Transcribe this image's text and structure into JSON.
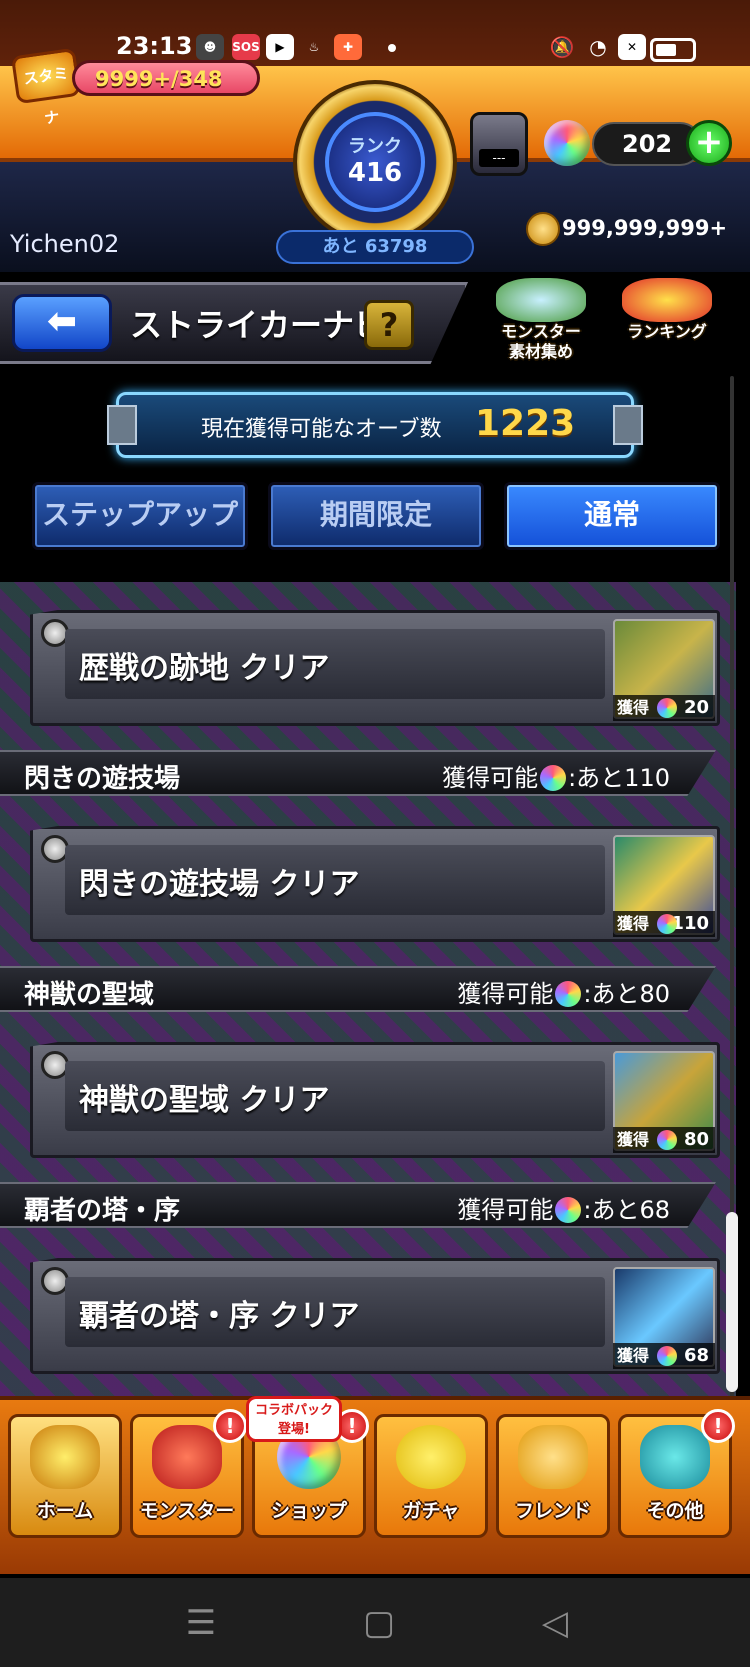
{
  "status_bar": {
    "time": "23:13",
    "icons": [
      "discord-icon",
      "sos-icon",
      "youtube-icon",
      "app-icon",
      "game-icon",
      "mute-icon",
      "wifi-icon",
      "sim-icon",
      "battery-icon"
    ],
    "sos_label": "SOS"
  },
  "header": {
    "stamina_label": "スタミナ",
    "stamina_value": "9999+/348",
    "rank_label": "ランク",
    "rank_value": "416",
    "rank_next": "あと 63798",
    "gauge_value": "---",
    "orb_count": "202",
    "username": "Yichen02",
    "coins": "999,999,999+"
  },
  "titlebar": {
    "title": "ストライカーナビ",
    "help": "?",
    "material_btn_line1": "モンスター",
    "material_btn_line2": "素材集め",
    "ranking_btn": "ランキング"
  },
  "orb_banner": {
    "label": "現在獲得可能なオーブ数",
    "value": "1223"
  },
  "tabs": [
    {
      "label": "ステップアップ",
      "active": false
    },
    {
      "label": "期間限定",
      "active": false
    },
    {
      "label": "通常",
      "active": true
    }
  ],
  "reward_prefix": "獲得",
  "sections": [
    {
      "mission": {
        "title": "歴戦の跡地 クリア",
        "reward": "20"
      }
    },
    {
      "name": "閃きの遊技場",
      "available_prefix": "獲得可能",
      "remaining": ":あと110",
      "mission": {
        "title": "閃きの遊技場 クリア",
        "reward": "110"
      }
    },
    {
      "name": "神獣の聖域",
      "available_prefix": "獲得可能",
      "remaining": ":あと80",
      "mission": {
        "title": "神獣の聖域 クリア",
        "reward": "80"
      }
    },
    {
      "name": "覇者の塔・序",
      "available_prefix": "獲得可能",
      "remaining": ":あと68",
      "mission": {
        "title": "覇者の塔・序 クリア",
        "reward": "68"
      }
    }
  ],
  "bottom_nav": {
    "collab_badge_line1": "コラボパック",
    "collab_badge_line2": "登場!",
    "alert": "!",
    "items": [
      {
        "label": "ホーム",
        "icon": "castle-icon"
      },
      {
        "label": "モンスター",
        "icon": "dragon-icon"
      },
      {
        "label": "ショップ",
        "icon": "orb-icon"
      },
      {
        "label": "ガチャ",
        "icon": "egg-icon"
      },
      {
        "label": "フレンド",
        "icon": "friends-icon"
      },
      {
        "label": "その他",
        "icon": "more-icon"
      }
    ]
  },
  "system_nav": {
    "menu": "☰",
    "home": "▢",
    "back": "◁"
  },
  "colors": {
    "accent_orange": "#f07a10",
    "tab_blue": "#1450d8",
    "gold": "#ffd84a"
  }
}
